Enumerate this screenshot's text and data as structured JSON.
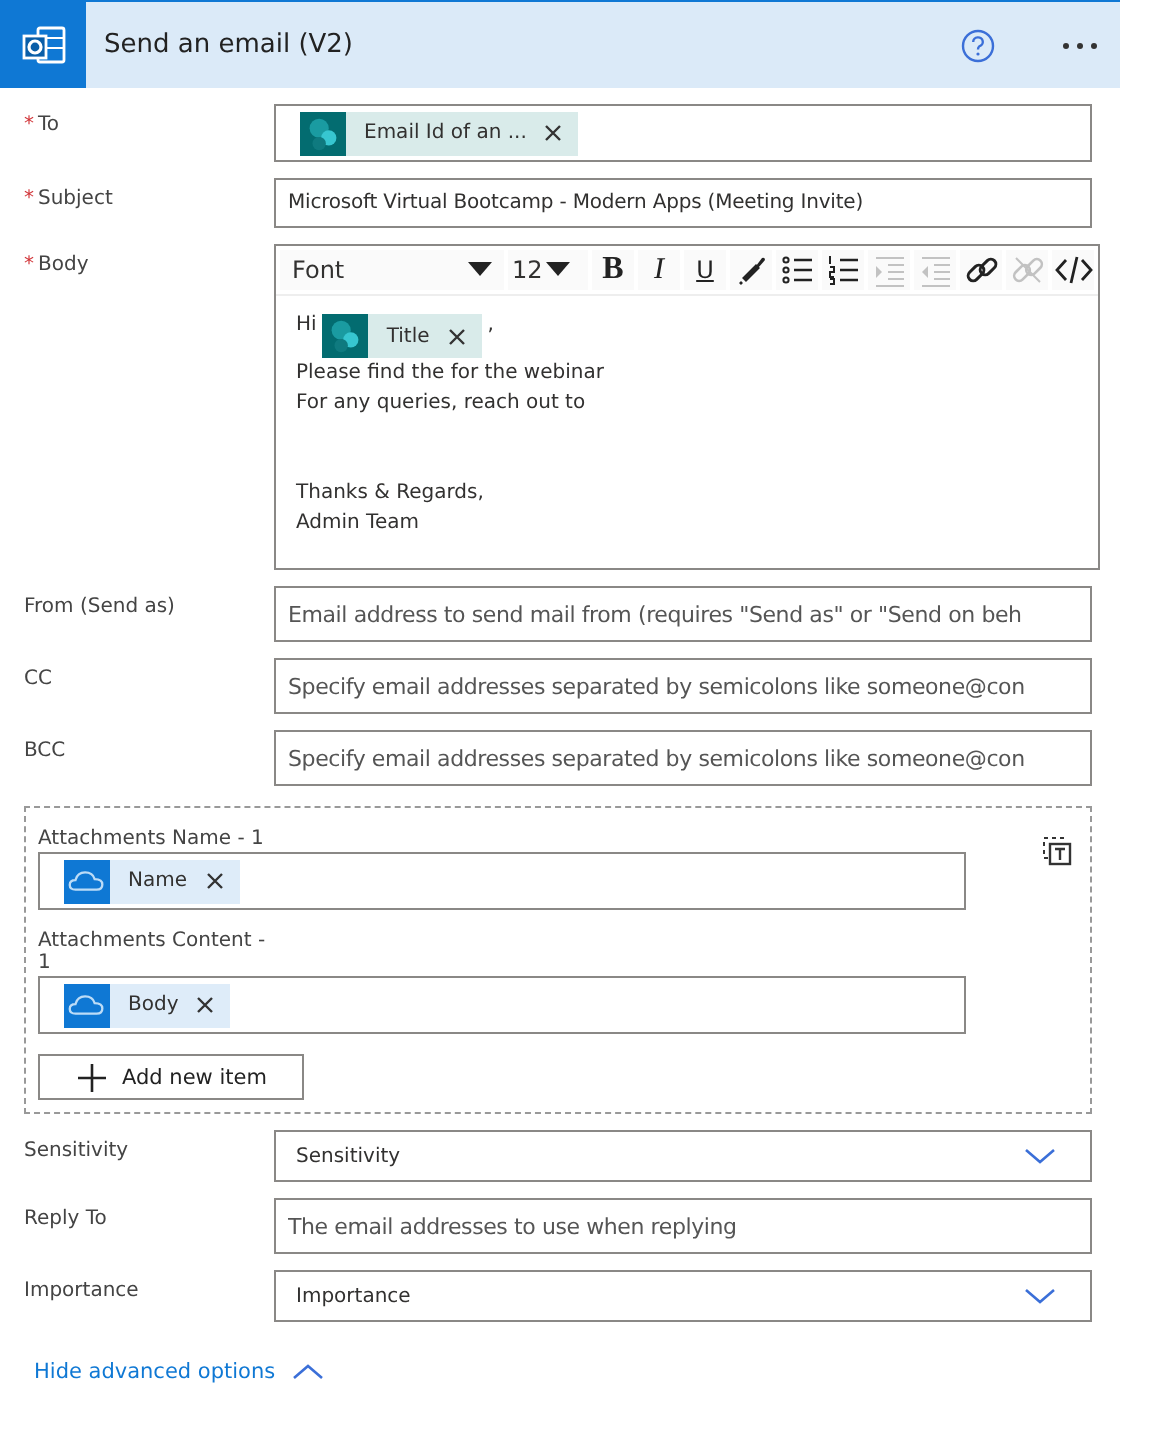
{
  "header": {
    "title": "Send an email (V2)"
  },
  "fields": [
    {
      "kind": "tokens",
      "label": "To",
      "required_mark": "*",
      "tokens": [
        {
          "label": "Email Id of an ...",
          "kind": "sharepoint"
        }
      ]
    },
    {
      "kind": "text",
      "label": "Subject",
      "required_mark": "*",
      "value": "Microsoft Virtual Bootcamp - Modern Apps (Meeting Invite)"
    },
    {
      "kind": "rich",
      "label": "Body",
      "required_mark": "*",
      "font": "Font",
      "size": "12",
      "tools": [
        {
          "kind": "bold",
          "glyph": "B",
          "disabled": false
        },
        {
          "kind": "italic",
          "glyph": "I",
          "disabled": false
        },
        {
          "kind": "underline",
          "glyph": "U",
          "disabled": false
        },
        {
          "kind": "color",
          "disabled": false
        },
        {
          "kind": "bullets",
          "disabled": false
        },
        {
          "kind": "numbering",
          "disabled": false
        },
        {
          "kind": "indent",
          "disabled": true
        },
        {
          "kind": "outdent",
          "disabled": true
        },
        {
          "kind": "link",
          "disabled": false
        },
        {
          "kind": "unlink",
          "disabled": true
        },
        {
          "kind": "code",
          "disabled": false
        }
      ],
      "lines": [
        {
          "kind": "text",
          "parts": [
            {
              "text": "Hi"
            },
            {
              "token": {
                "label": "Title",
                "kind": "sharepoint"
              }
            },
            {
              "text": ","
            }
          ]
        },
        {
          "kind": "text",
          "parts": [
            {
              "text": "Please find the for the webinar"
            }
          ]
        },
        {
          "kind": "text",
          "parts": [
            {
              "text": "For any queries, reach out to"
            }
          ]
        },
        {
          "kind": "blank"
        },
        {
          "kind": "blank"
        },
        {
          "kind": "text",
          "parts": [
            {
              "text": "Thanks & Regards,"
            }
          ]
        },
        {
          "kind": "text",
          "parts": [
            {
              "text": "Admin Team"
            }
          ]
        }
      ]
    },
    {
      "kind": "text",
      "label": "From (Send as)",
      "placeholder": "Email address to send mail from (requires \"Send as\" or \"Send on beh"
    },
    {
      "kind": "text",
      "label": "CC",
      "placeholder": "Specify email addresses separated by semicolons like someone@con"
    },
    {
      "kind": "text",
      "label": "BCC",
      "placeholder": "Specify email addresses separated by semicolons like someone@con"
    },
    {
      "kind": "array",
      "items": [
        {
          "fields": [
            {
              "label": "Attachments Name - 1",
              "tokens": [
                {
                  "label": "Name",
                  "kind": "onedrive"
                }
              ]
            },
            {
              "label": "Attachments Content - 1",
              "tokens": [
                {
                  "label": "Body",
                  "kind": "onedrive"
                }
              ]
            }
          ]
        }
      ],
      "add_label": "Add new item"
    },
    {
      "kind": "dropdown",
      "label": "Sensitivity",
      "value": "Sensitivity"
    },
    {
      "kind": "text",
      "label": "Reply To",
      "placeholder": "The email addresses to use when replying"
    },
    {
      "kind": "dropdown",
      "label": "Importance",
      "value": "Importance"
    }
  ],
  "advanced_link": {
    "label": "Hide advanced options",
    "expanded": true
  }
}
